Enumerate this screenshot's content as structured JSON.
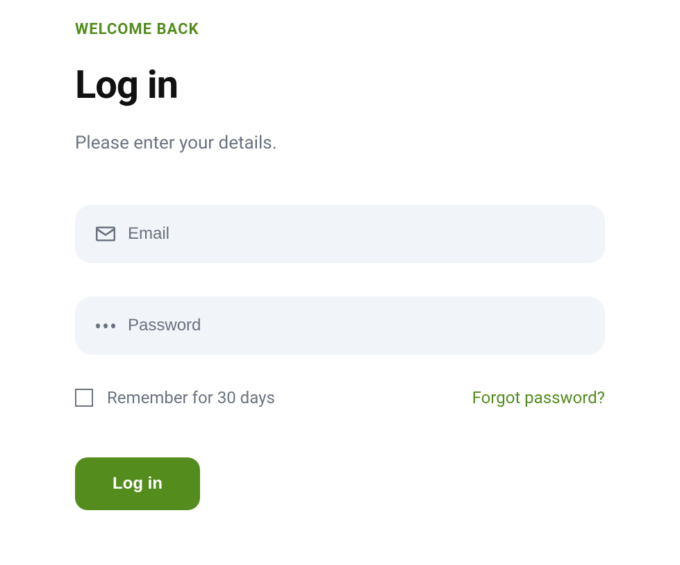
{
  "header": {
    "welcome": "WELCOME BACK",
    "title": "Log in",
    "subtitle": "Please enter your details."
  },
  "form": {
    "email": {
      "placeholder": "Email",
      "value": ""
    },
    "password": {
      "placeholder": "Password",
      "value": ""
    },
    "remember_label": "Remember for 30 days",
    "forgot_label": "Forgot password?",
    "submit_label": "Log in"
  }
}
